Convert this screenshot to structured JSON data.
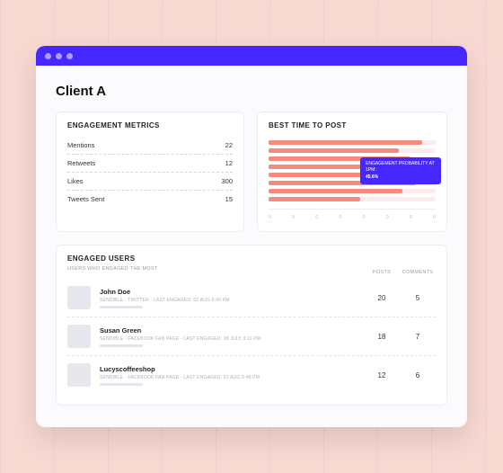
{
  "page": {
    "title": "Client A"
  },
  "cards": {
    "metrics_title": "ENGAGEMENT METRICS",
    "posttime_title": "BEST TIME TO POST",
    "engaged_title": "ENGAGED USERS",
    "engaged_subtitle": "USERS WHO ENGAGED THE MOST",
    "col_posts": "POSTS",
    "col_comments": "COMMENTS"
  },
  "metrics": [
    {
      "label": "Mentions",
      "value": "22"
    },
    {
      "label": "Retweets",
      "value": "12"
    },
    {
      "label": "Likes",
      "value": "300"
    },
    {
      "label": "Tweets Sent",
      "value": "15"
    }
  ],
  "chart_data": {
    "type": "bar",
    "orientation": "horizontal",
    "categories": [
      "0",
      "0",
      "0",
      "0",
      "0",
      "0",
      "0",
      "0"
    ],
    "values": [
      92,
      78,
      85,
      60,
      72,
      88,
      80,
      55
    ],
    "ylim": [
      0,
      100
    ],
    "tooltip": {
      "label": "ENGAGEMENT PROBABILITY AT 1PM:",
      "value": "45.6%"
    },
    "colors": {
      "bar": "#f58a7c",
      "track": "#fcecec",
      "tooltip": "#4727ff"
    }
  },
  "users": [
    {
      "name": "John Doe",
      "meta": "SENDIBLE - TWITTER - LAST ENGAGED: 02 AUG 6:40 PM",
      "posts": "20",
      "comments": "5"
    },
    {
      "name": "Susan Green",
      "meta": "SENDIBLE - FACEBOOK FAN PAGE - LAST ENGAGED: 28 JULY 3:11 PM",
      "posts": "18",
      "comments": "7"
    },
    {
      "name": "Lucyscoffeeshop",
      "meta": "SENDIBLE - FACEBOOK FAN PAGE - LAST ENGAGED: 01 AUG 5:48 PM",
      "posts": "12",
      "comments": "6"
    }
  ]
}
